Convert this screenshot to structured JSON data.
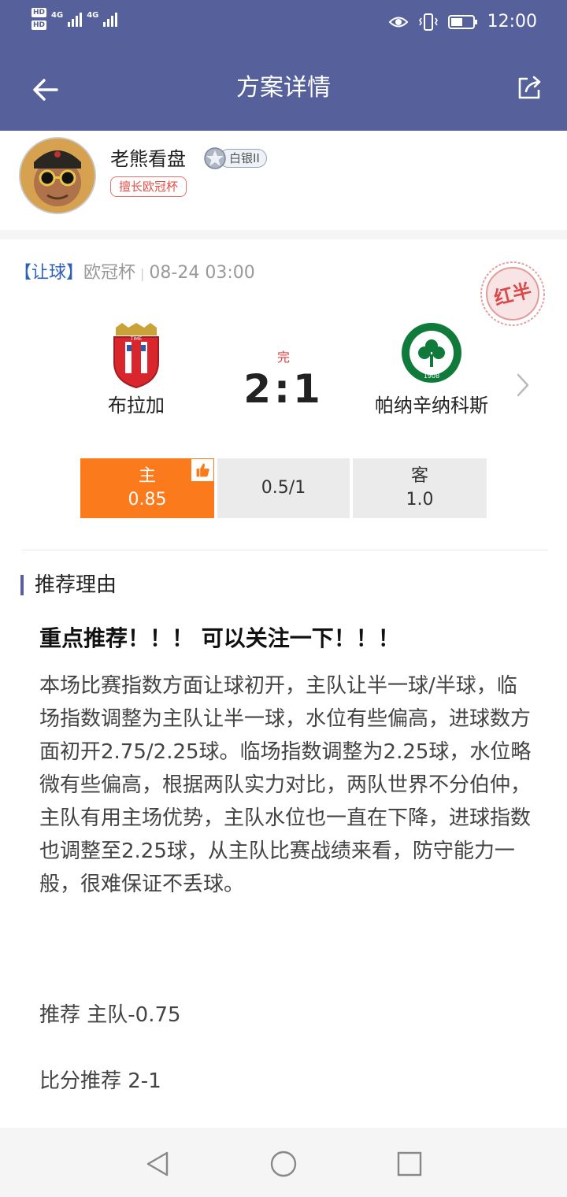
{
  "status_bar": {
    "hd1": "HD",
    "hd2": "HD",
    "net1": "4G",
    "net2": "4G",
    "time": "12:00"
  },
  "app_bar": {
    "title": "方案详情"
  },
  "author": {
    "name": "老熊看盘",
    "rank": "白银II",
    "specialty": "擅长欧冠杯"
  },
  "match": {
    "bet_type": "【让球】",
    "league": "欧冠杯",
    "datetime": "08-24  03:00",
    "result_stamp": "红半",
    "status": "完",
    "score": "2:1",
    "home_team": "布拉加",
    "away_team": "帕纳辛纳科斯",
    "odds": {
      "home_label": "主",
      "home_value": "0.85",
      "handicap": "0.5/1",
      "away_label": "客",
      "away_value": "1.0"
    }
  },
  "reason": {
    "section_title": "推荐理由",
    "headline": "重点推荐！！！ 可以关注一下！！！",
    "body": "本场比赛指数方面让球初开，主队让半一球/半球，临场指数调整为主队让半一球，水位有些偏高，进球数方面初开2.75/2.25球。临场指数调整为2.25球，水位略微有些偏高，根据两队实力对比，两队世界不分伯仲，主队有用主场优势，主队水位也一直在下降，进球指数也调整至2.25球，从主队比赛战绩来看，防守能力一般，很难保证不丢球。",
    "recommend": "推荐  主队-0.75",
    "score_recommend": "比分推荐  2-1"
  },
  "colors": {
    "primary": "#56609a",
    "home_odds_bg": "#fa7a1c",
    "stamp_red": "#d94a4a",
    "tag_blue": "#2f62b4"
  },
  "icons": {
    "back": "arrow-left-icon",
    "share": "share-icon",
    "chevron": "chevron-right-icon",
    "thumb": "thumbs-up-icon"
  }
}
